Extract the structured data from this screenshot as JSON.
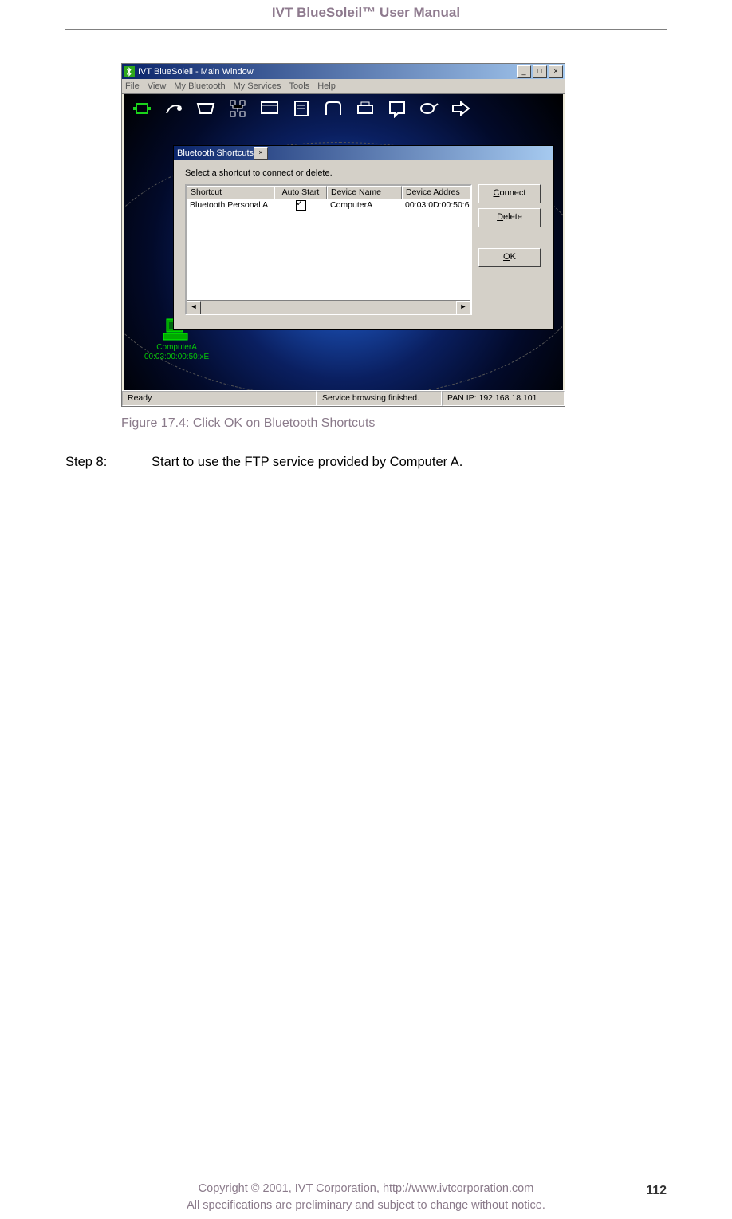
{
  "document": {
    "header": "IVT BlueSoleil™ User Manual",
    "caption": "Figure 17.4: Click OK on Bluetooth Shortcuts",
    "step_label": "Step 8:",
    "step_text": "Start to use the FTP service provided by Computer A.",
    "footer_line1_pre": "Copyright © 2001, IVT Corporation, ",
    "footer_link": "http://www.ivtcorporation.com",
    "footer_line2": "All specifications are preliminary and subject to change without notice.",
    "page_number": "112"
  },
  "mainwin": {
    "title": "IVT BlueSoleil - Main Window",
    "menu": [
      "File",
      "View",
      "My Bluetooth",
      "My Services",
      "Tools",
      "Help"
    ],
    "device_name": "ComputerA",
    "device_addr": "00:03:00:00:50:xE",
    "status": {
      "left": "Ready",
      "mid": "Service browsing finished.",
      "right": "PAN IP: 192.168.18.101"
    }
  },
  "dialog": {
    "title": "Bluetooth Shortcuts",
    "instruction": "Select a shortcut to connect or delete.",
    "columns": [
      "Shortcut",
      "Auto Start",
      "Device Name",
      "Device Addres"
    ],
    "row": {
      "shortcut": "Bluetooth Personal A",
      "device_name": "ComputerA",
      "device_addr": "00:03:0D:00:50:6"
    },
    "buttons": {
      "connect": "Connect",
      "delete": "Delete",
      "ok": "OK"
    }
  }
}
